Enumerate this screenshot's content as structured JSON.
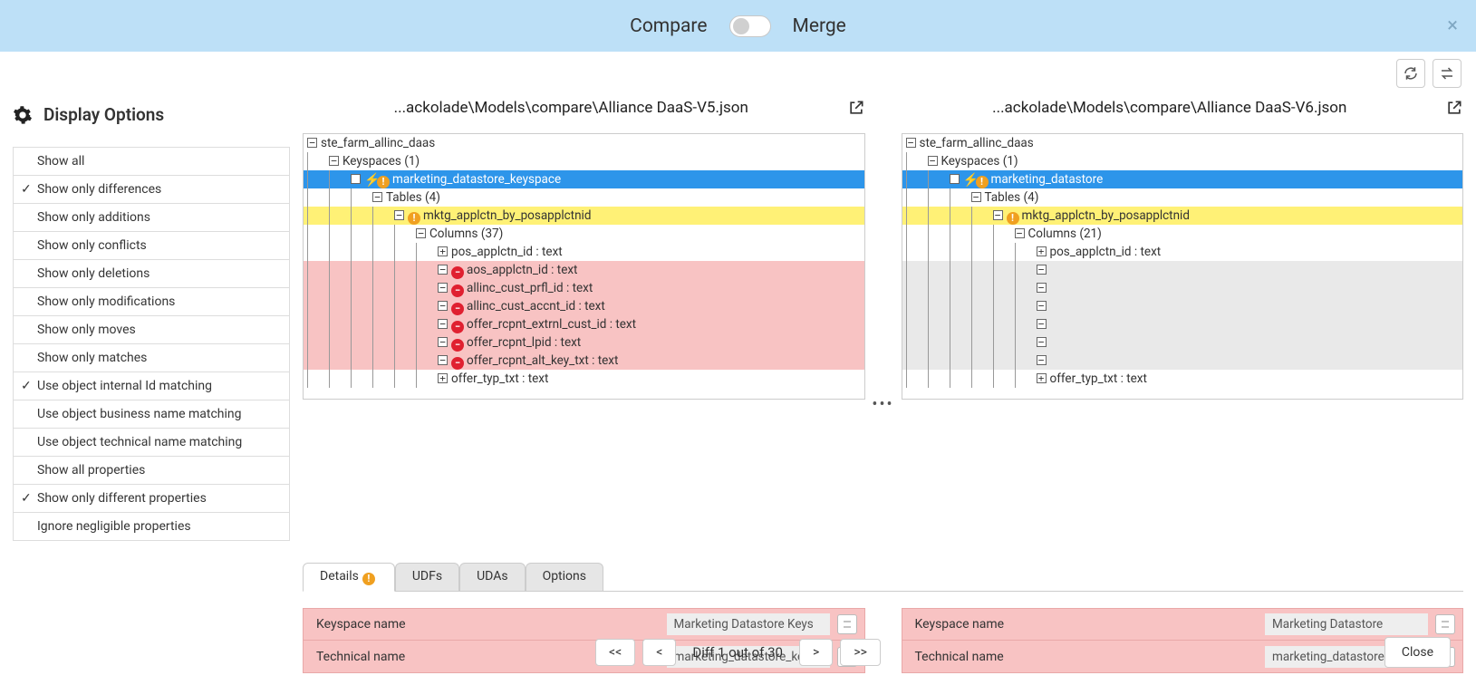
{
  "header": {
    "compare_label": "Compare",
    "merge_label": "Merge",
    "toggle_state": "compare"
  },
  "display_options": {
    "title": "Display Options",
    "items": [
      {
        "label": "Show all",
        "checked": false
      },
      {
        "label": "Show only differences",
        "checked": true
      },
      {
        "label": "Show only additions",
        "checked": false
      },
      {
        "label": "Show only conflicts",
        "checked": false
      },
      {
        "label": "Show only deletions",
        "checked": false
      },
      {
        "label": "Show only modifications",
        "checked": false
      },
      {
        "label": "Show only moves",
        "checked": false
      },
      {
        "label": "Show only matches",
        "checked": false
      },
      {
        "label": "Use object internal Id matching",
        "checked": true
      },
      {
        "label": "Use object business name matching",
        "checked": false
      },
      {
        "label": "Use object technical name matching",
        "checked": false
      },
      {
        "label": "Show all properties",
        "checked": false
      },
      {
        "label": "Show only different properties",
        "checked": true
      },
      {
        "label": "Ignore negligible properties",
        "checked": false
      }
    ]
  },
  "left_model": {
    "path": "...ackolade\\Models\\compare\\Alliance DaaS-V5.json",
    "tree": [
      {
        "depth": 0,
        "exp": "-",
        "label": "ste_farm_allinc_daas",
        "cls": ""
      },
      {
        "depth": 1,
        "exp": "-",
        "label": "Keyspaces (1)",
        "cls": ""
      },
      {
        "depth": 2,
        "exp": "-",
        "bolt": true,
        "warn": true,
        "label": "marketing_datastore_keyspace",
        "cls": "bg-selected"
      },
      {
        "depth": 3,
        "exp": "-",
        "label": "Tables (4)",
        "cls": ""
      },
      {
        "depth": 4,
        "exp": "-",
        "warn": true,
        "label": "mktg_applctn_by_posapplctnid",
        "cls": "bg-modified"
      },
      {
        "depth": 5,
        "exp": "-",
        "label": "Columns (37)",
        "cls": ""
      },
      {
        "depth": 6,
        "exp": "+",
        "label": "pos_applctn_id : text",
        "cls": ""
      },
      {
        "depth": 6,
        "exp": "-",
        "del": true,
        "label": "aos_applctn_id : text",
        "cls": "bg-deleted"
      },
      {
        "depth": 6,
        "exp": "-",
        "del": true,
        "label": "allinc_cust_prfl_id : text",
        "cls": "bg-deleted"
      },
      {
        "depth": 6,
        "exp": "-",
        "del": true,
        "label": "allinc_cust_accnt_id : text",
        "cls": "bg-deleted"
      },
      {
        "depth": 6,
        "exp": "-",
        "del": true,
        "label": "offer_rcpnt_extrnl_cust_id : text",
        "cls": "bg-deleted"
      },
      {
        "depth": 6,
        "exp": "-",
        "del": true,
        "label": "offer_rcpnt_lpid : text",
        "cls": "bg-deleted"
      },
      {
        "depth": 6,
        "exp": "-",
        "del": true,
        "label": "offer_rcpnt_alt_key_txt : text",
        "cls": "bg-deleted"
      },
      {
        "depth": 6,
        "exp": "+",
        "label": "offer_typ_txt : text",
        "cls": ""
      }
    ]
  },
  "right_model": {
    "path": "...ackolade\\Models\\compare\\Alliance DaaS-V6.json",
    "tree": [
      {
        "depth": 0,
        "exp": "-",
        "label": "ste_farm_allinc_daas",
        "cls": ""
      },
      {
        "depth": 1,
        "exp": "-",
        "label": "Keyspaces (1)",
        "cls": ""
      },
      {
        "depth": 2,
        "exp": "-",
        "bolt": true,
        "warn": true,
        "label": "marketing_datastore",
        "cls": "bg-selected"
      },
      {
        "depth": 3,
        "exp": "-",
        "label": "Tables (4)",
        "cls": ""
      },
      {
        "depth": 4,
        "exp": "-",
        "warn": true,
        "label": "mktg_applctn_by_posapplctnid",
        "cls": "bg-modified"
      },
      {
        "depth": 5,
        "exp": "-",
        "label": "Columns (21)",
        "cls": ""
      },
      {
        "depth": 6,
        "exp": "+",
        "label": "pos_applctn_id : text",
        "cls": ""
      },
      {
        "depth": 6,
        "exp": "-",
        "label": "",
        "cls": "bg-placeholder"
      },
      {
        "depth": 6,
        "exp": "-",
        "label": "",
        "cls": "bg-placeholder"
      },
      {
        "depth": 6,
        "exp": "-",
        "label": "",
        "cls": "bg-placeholder"
      },
      {
        "depth": 6,
        "exp": "-",
        "label": "",
        "cls": "bg-placeholder"
      },
      {
        "depth": 6,
        "exp": "-",
        "label": "",
        "cls": "bg-placeholder"
      },
      {
        "depth": 6,
        "exp": "-",
        "label": "",
        "cls": "bg-placeholder"
      },
      {
        "depth": 6,
        "exp": "+",
        "label": "offer_typ_txt : text",
        "cls": ""
      }
    ]
  },
  "tabs": [
    {
      "label": "Details",
      "active": true,
      "warn": true
    },
    {
      "label": "UDFs",
      "active": false
    },
    {
      "label": "UDAs",
      "active": false
    },
    {
      "label": "Options",
      "active": false
    }
  ],
  "left_props": [
    {
      "label": "Keyspace name",
      "value": "Marketing Datastore Keys"
    },
    {
      "label": "Technical name",
      "value": "marketing_datastore_keys"
    }
  ],
  "right_props": [
    {
      "label": "Keyspace name",
      "value": "Marketing Datastore"
    },
    {
      "label": "Technical name",
      "value": "marketing_datastore"
    }
  ],
  "footer": {
    "first": "<<",
    "prev": "<",
    "counter": "Diff 1 out of 30",
    "next": ">",
    "last": ">>",
    "close": "Close"
  },
  "badge_colors": {
    "warn": "#f0a020",
    "del": "#e02030"
  }
}
